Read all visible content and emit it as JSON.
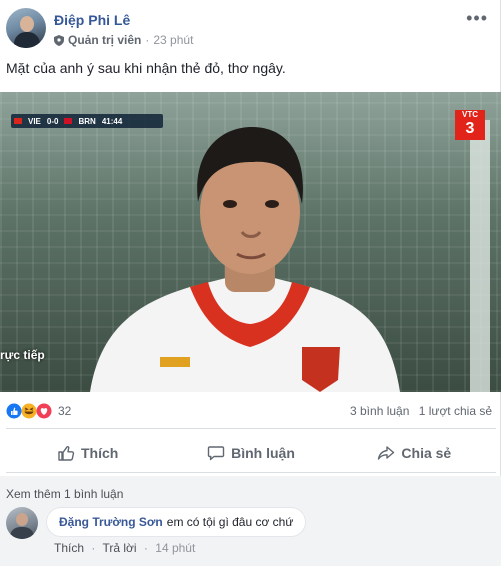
{
  "post": {
    "author": "Điệp Phi Lê",
    "role": "Quản trị viên",
    "time": "23 phút",
    "more_label": "•••",
    "text": "Mặt của anh ý sau khi nhận thẻ đỏ, thơ ngây."
  },
  "media": {
    "score_left": "VIE",
    "score": "0-0",
    "score_right": "BRN",
    "clock": "41:44",
    "channel_top": "VTC",
    "channel_number": "3",
    "live_text": "rực tiếp"
  },
  "reactions": {
    "icons": [
      "like-icon",
      "haha-icon",
      "love-icon"
    ],
    "count": "32",
    "comments": "3 bình luận",
    "shares": "1 lượt chia sẻ"
  },
  "actions": {
    "like": "Thích",
    "comment": "Bình luận",
    "share": "Chia sẻ"
  },
  "comments": {
    "view_more": "Xem thêm 1 bình luận",
    "items": [
      {
        "name": "Đặng Trường Sơn",
        "text": "em có tội gì đâu cơ chứ",
        "like": "Thích",
        "reply": "Trả lời",
        "time": "14 phút"
      }
    ]
  },
  "colors": {
    "link_blue": "#365899",
    "secondary_text": "#606770",
    "like_blue": "#1877f2",
    "love_red": "#f33e58",
    "haha_yellow": "#f7b125"
  }
}
